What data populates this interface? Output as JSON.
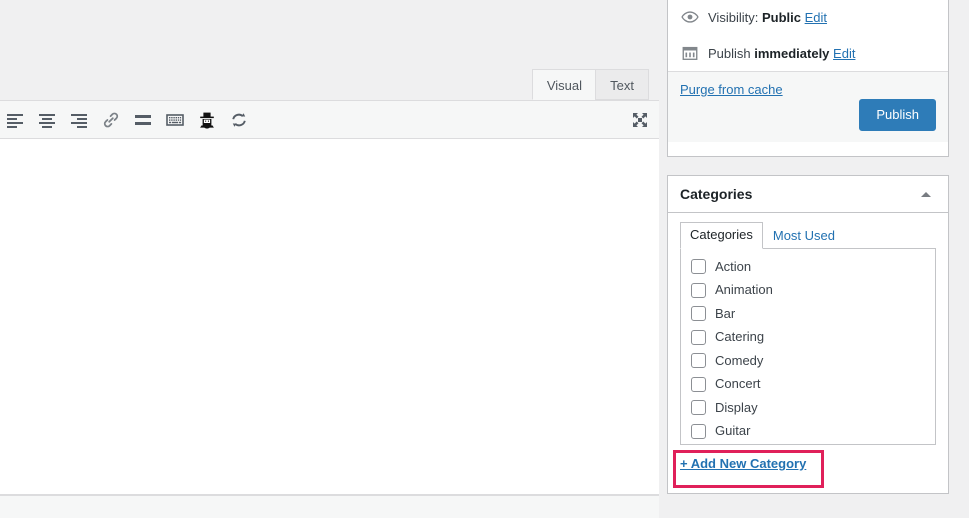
{
  "editor": {
    "tabs": [
      {
        "label": "Visual",
        "active": true
      },
      {
        "label": "Text",
        "active": false
      }
    ],
    "toolbar_buttons": [
      {
        "icon": "align-left-icon",
        "title": "Align left"
      },
      {
        "icon": "align-center-icon",
        "title": "Align center"
      },
      {
        "icon": "align-right-icon",
        "title": "Align right"
      },
      {
        "icon": "insert-link-icon",
        "title": "Insert/edit link"
      },
      {
        "icon": "read-more-icon",
        "title": "Insert Read More tag"
      },
      {
        "icon": "keyboard-shortcuts-icon",
        "title": "Keyboard shortcuts"
      },
      {
        "icon": "spam-hat-icon",
        "title": "Toolbar Toggle"
      },
      {
        "icon": "sync-refresh-icon",
        "title": "Refresh"
      }
    ],
    "fullscreen_button": {
      "icon": "distraction-free-icon",
      "title": "Distraction-free writing mode"
    },
    "content": ""
  },
  "publish_box": {
    "visibility": {
      "icon": "eye-icon",
      "label": "Visibility:",
      "value": "Public",
      "edit_label": "Edit"
    },
    "schedule": {
      "icon": "calendar-icon",
      "label": "Publish",
      "value": "immediately",
      "edit_label": "Edit"
    },
    "purge_link": "Purge from cache",
    "publish_button": "Publish"
  },
  "categories_box": {
    "title": "Categories",
    "toggle_icon": "chevron-up-icon",
    "tabs": [
      {
        "label": "Categories",
        "active": true
      },
      {
        "label": "Most Used",
        "active": false
      }
    ],
    "items": [
      {
        "label": "Action",
        "checked": false
      },
      {
        "label": "Animation",
        "checked": false
      },
      {
        "label": "Bar",
        "checked": false
      },
      {
        "label": "Catering",
        "checked": false
      },
      {
        "label": "Comedy",
        "checked": false
      },
      {
        "label": "Concert",
        "checked": false
      },
      {
        "label": "Display",
        "checked": false
      },
      {
        "label": "Guitar",
        "checked": false
      }
    ],
    "add_new_link": "+ Add New Category"
  },
  "colors": {
    "accent": "#2271b1",
    "publish_button": "#2e7cb8",
    "highlight_annotation": "#e0205a",
    "page_background": "#f0f0f1",
    "panel_border": "#c3c4c7"
  }
}
